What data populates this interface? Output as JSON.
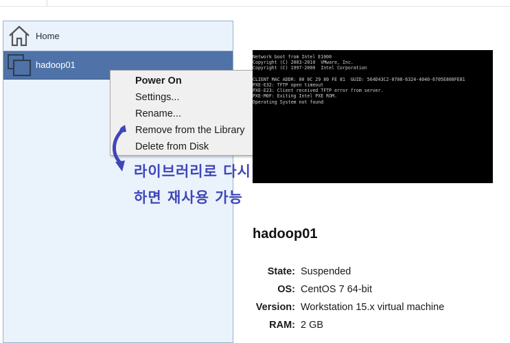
{
  "library": {
    "items": [
      {
        "label": "Home",
        "icon": "home-icon"
      },
      {
        "label": "hadoop01",
        "icon": "vm-icon"
      }
    ]
  },
  "context_menu": {
    "items": [
      {
        "label": "Power On",
        "bold": true
      },
      {
        "label": "Settings..."
      },
      {
        "label": "Rename..."
      },
      {
        "label": "Remove from the Library"
      },
      {
        "label": "Delete from Disk"
      }
    ]
  },
  "annotation": {
    "line1": "라이브러리로 다시 오픈",
    "line2": "하면 재사용 가능",
    "color": "#4046b8"
  },
  "console": {
    "lines": [
      "Network boot from Intel E1000",
      "Copyright (C) 2003-2010  VMware, Inc.",
      "Copyright (C) 1997-2000  Intel Corporation",
      "",
      "CLIENT MAC ADDR: 00 0C 29 80 FE 81  GUID: 564D43C2-0708-6324-4040-6705E808FE81",
      "PXE-E32: TFTP open timeout",
      "PXE-E23: Client received TFTP error from server.",
      "PXE-M0F: Exiting Intel PXE ROM.",
      "Operating System not found"
    ]
  },
  "vm": {
    "title": "hadoop01",
    "details": [
      {
        "key": "State:",
        "value": "Suspended"
      },
      {
        "key": "OS:",
        "value": "CentOS 7 64-bit"
      },
      {
        "key": "Version:",
        "value": "Workstation 15.x virtual machine"
      },
      {
        "key": "RAM:",
        "value": "2 GB"
      }
    ]
  },
  "colors": {
    "selection": "#4f73a8",
    "library_bg": "#eaf2fb"
  }
}
